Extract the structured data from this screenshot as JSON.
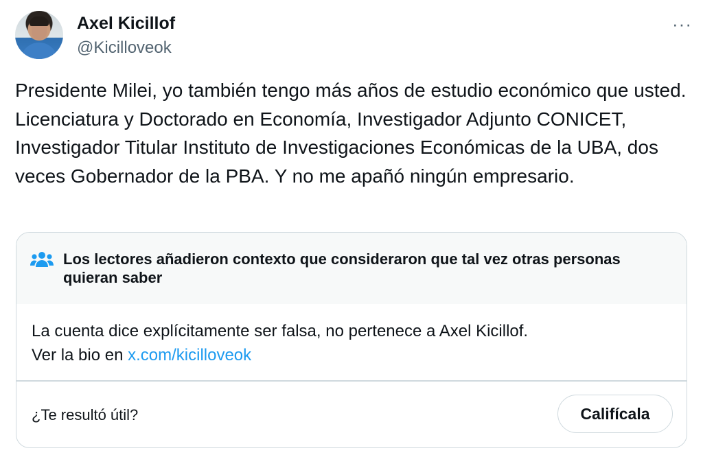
{
  "author": {
    "name": "Axel Kicillof",
    "handle": "@Kicilloveok"
  },
  "more_icon": "more-horizontal-icon",
  "tweet": {
    "text": "Presidente Milei, yo también tengo más años de estudio económico que usted. Licenciatura y Doctorado en Economía, Investigador Adjunto CONICET, Investigador Titular Instituto de Investigaciones Económicas de la UBA, dos veces Gobernador de la PBA. Y no me apañó ningún empresario."
  },
  "community_note": {
    "icon": "people-icon",
    "title": "Los lectores añadieron contexto que consideraron que tal vez otras personas quieran saber",
    "body_line1": "La cuenta dice explícitamente ser falsa, no pertenece a Axel Kicillof.",
    "body_line2_prefix": "Ver la bio en ",
    "body_link": "x.com/kicilloveok",
    "question": "¿Te resultó útil?",
    "rate_button": "Califícala"
  },
  "colors": {
    "link": "#1d9bf0",
    "secondary_text": "#536471",
    "note_header_bg": "#f7f9f9"
  }
}
